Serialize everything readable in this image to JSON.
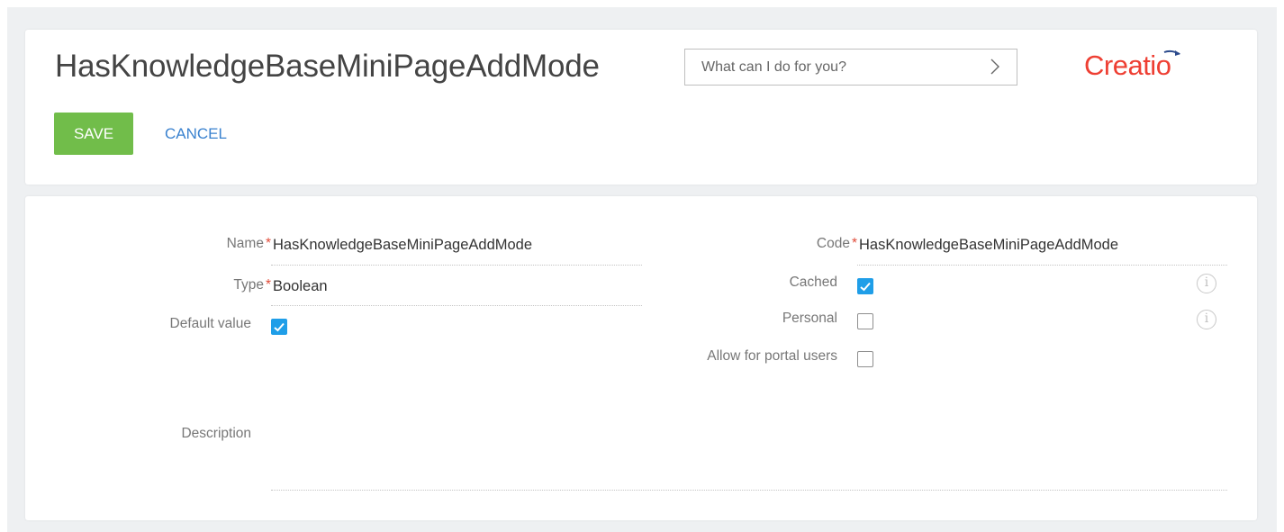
{
  "header": {
    "title": "HasKnowledgeBaseMiniPageAddMode",
    "search": {
      "placeholder": "What can I do for you?",
      "value": ""
    },
    "logo_text": "Creatio",
    "save_label": "SAVE",
    "cancel_label": "CANCEL"
  },
  "form": {
    "name": {
      "label": "Name",
      "required_mark": "*",
      "value": "HasKnowledgeBaseMiniPageAddMode"
    },
    "type": {
      "label": "Type",
      "required_mark": "*",
      "value": "Boolean"
    },
    "default_value": {
      "label": "Default value",
      "checked": true
    },
    "code": {
      "label": "Code",
      "required_mark": "*",
      "value": "HasKnowledgeBaseMiniPageAddMode"
    },
    "cached": {
      "label": "Cached",
      "checked": true,
      "info_icon": "info-icon"
    },
    "personal": {
      "label": "Personal",
      "checked": false,
      "info_icon": "info-icon"
    },
    "allow_portal": {
      "label": "Allow for portal users",
      "checked": false
    },
    "description": {
      "label": "Description",
      "value": ""
    }
  },
  "colors": {
    "save_button": "#71bd4a",
    "cancel_link": "#3a82cf",
    "checkbox_checked": "#1f9ee8",
    "required_mark": "#e14c3a",
    "logo": "#ee3f33"
  }
}
